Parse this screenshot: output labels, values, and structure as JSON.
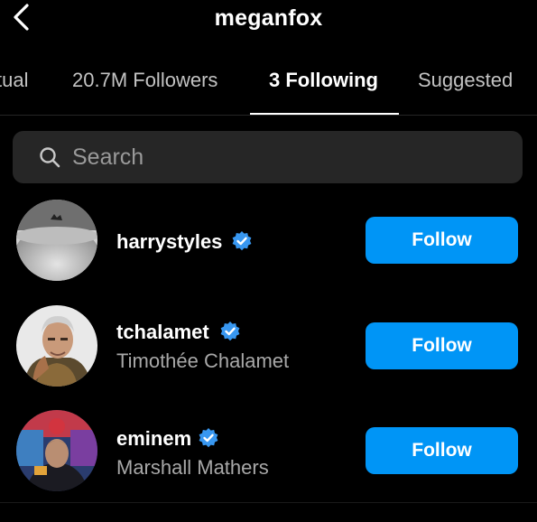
{
  "header": {
    "title": "meganfox"
  },
  "tabs": [
    {
      "label": "tual"
    },
    {
      "label": "20.7M Followers"
    },
    {
      "label": "3 Following",
      "active": true
    },
    {
      "label": "Suggested"
    }
  ],
  "search": {
    "placeholder": "Search",
    "value": ""
  },
  "accounts": [
    {
      "username": "harrystyles",
      "full_name": "",
      "verified": true,
      "button": "Follow"
    },
    {
      "username": "tchalamet",
      "full_name": "Timothée Chalamet",
      "verified": true,
      "button": "Follow"
    },
    {
      "username": "eminem",
      "full_name": "Marshall Mathers",
      "verified": true,
      "button": "Follow"
    }
  ],
  "colors": {
    "background": "#000000",
    "follow_button": "#0095f6",
    "verified_badge": "#3897f0",
    "search_bg": "#262626"
  },
  "icons": {
    "back": "chevron-left-icon",
    "search": "search-icon",
    "verified": "verified-badge-icon"
  }
}
